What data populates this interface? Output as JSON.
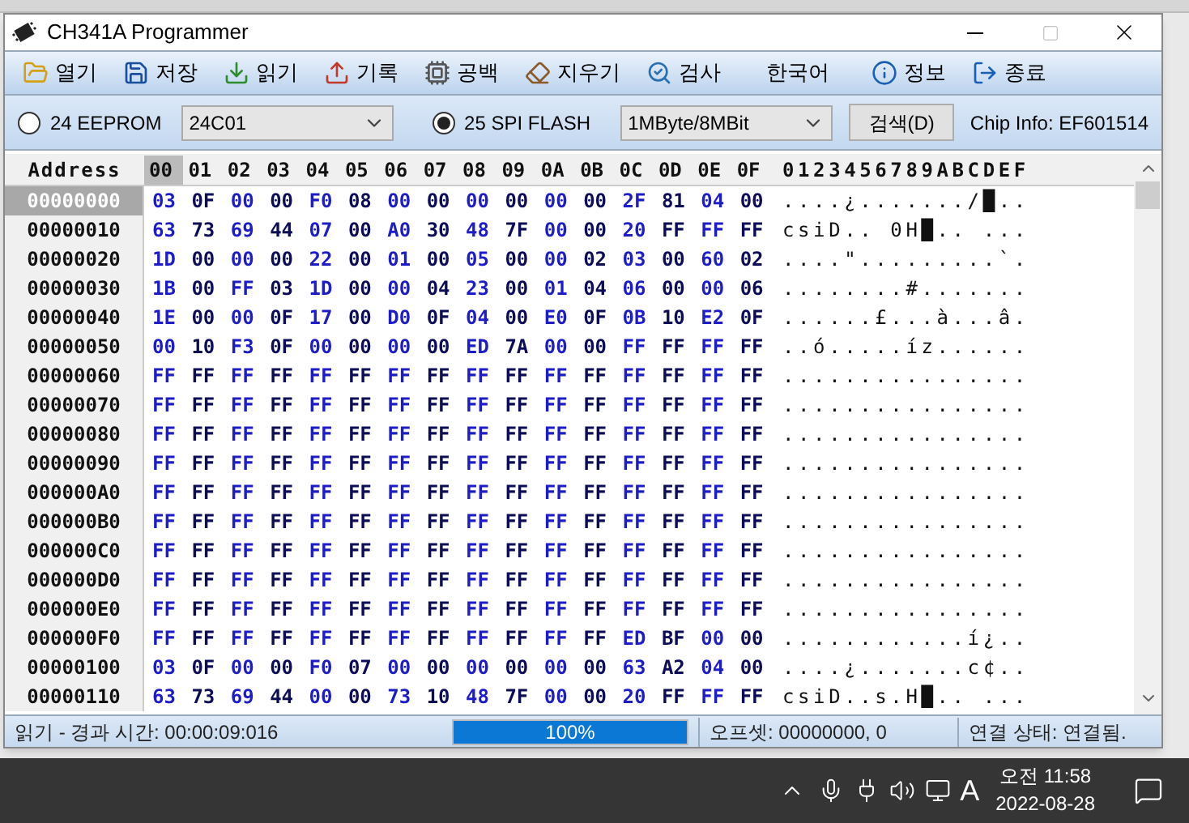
{
  "window": {
    "title": "CH341A Programmer"
  },
  "toolbar": [
    {
      "kind": "open",
      "label": "열기"
    },
    {
      "kind": "save",
      "label": "저장"
    },
    {
      "kind": "read",
      "label": "읽기"
    },
    {
      "kind": "write",
      "label": "기록"
    },
    {
      "kind": "blank",
      "label": "공백"
    },
    {
      "kind": "erase",
      "label": "지우기"
    },
    {
      "kind": "verify",
      "label": "검사"
    },
    {
      "kind": "language",
      "label": "한국어"
    },
    {
      "kind": "info",
      "label": "정보"
    },
    {
      "kind": "exit",
      "label": "종료"
    }
  ],
  "options": {
    "chip_types": [
      {
        "label": "24 EEPROM",
        "selected": false,
        "select_value": "24C01"
      },
      {
        "label": "25 SPI FLASH",
        "selected": true,
        "select_value": "1MByte/8MBit"
      }
    ],
    "detect_button": "검색(D)",
    "chip_info": "Chip Info: EF601514"
  },
  "hex": {
    "address_header": "Address",
    "columns": [
      "00",
      "01",
      "02",
      "03",
      "04",
      "05",
      "06",
      "07",
      "08",
      "09",
      "0A",
      "0B",
      "0C",
      "0D",
      "0E",
      "0F"
    ],
    "ascii_header": "0123456789ABCDEF",
    "rows": [
      {
        "address": "00000000",
        "selected": true,
        "bytes": [
          "03",
          "0F",
          "00",
          "00",
          "F0",
          "08",
          "00",
          "00",
          "00",
          "00",
          "00",
          "00",
          "2F",
          "81",
          "04",
          "00"
        ],
        "ascii": "....¿......./█.."
      },
      {
        "address": "00000010",
        "selected": false,
        "bytes": [
          "63",
          "73",
          "69",
          "44",
          "07",
          "00",
          "A0",
          "30",
          "48",
          "7F",
          "00",
          "00",
          "20",
          "FF",
          "FF",
          "FF"
        ],
        "ascii": "csiD.. 0H█.. ..."
      },
      {
        "address": "00000020",
        "selected": false,
        "bytes": [
          "1D",
          "00",
          "00",
          "00",
          "22",
          "00",
          "01",
          "00",
          "05",
          "00",
          "00",
          "02",
          "03",
          "00",
          "60",
          "02"
        ],
        "ascii": "....\".........`."
      },
      {
        "address": "00000030",
        "selected": false,
        "bytes": [
          "1B",
          "00",
          "FF",
          "03",
          "1D",
          "00",
          "00",
          "04",
          "23",
          "00",
          "01",
          "04",
          "06",
          "00",
          "00",
          "06"
        ],
        "ascii": "........#......."
      },
      {
        "address": "00000040",
        "selected": false,
        "bytes": [
          "1E",
          "00",
          "00",
          "0F",
          "17",
          "00",
          "D0",
          "0F",
          "04",
          "00",
          "E0",
          "0F",
          "0B",
          "10",
          "E2",
          "0F"
        ],
        "ascii": "......£...à...â."
      },
      {
        "address": "00000050",
        "selected": false,
        "bytes": [
          "00",
          "10",
          "F3",
          "0F",
          "00",
          "00",
          "00",
          "00",
          "ED",
          "7A",
          "00",
          "00",
          "FF",
          "FF",
          "FF",
          "FF"
        ],
        "ascii": "..ó.....íz......"
      },
      {
        "address": "00000060",
        "selected": false,
        "bytes": [
          "FF",
          "FF",
          "FF",
          "FF",
          "FF",
          "FF",
          "FF",
          "FF",
          "FF",
          "FF",
          "FF",
          "FF",
          "FF",
          "FF",
          "FF",
          "FF"
        ],
        "ascii": "................"
      },
      {
        "address": "00000070",
        "selected": false,
        "bytes": [
          "FF",
          "FF",
          "FF",
          "FF",
          "FF",
          "FF",
          "FF",
          "FF",
          "FF",
          "FF",
          "FF",
          "FF",
          "FF",
          "FF",
          "FF",
          "FF"
        ],
        "ascii": "................"
      },
      {
        "address": "00000080",
        "selected": false,
        "bytes": [
          "FF",
          "FF",
          "FF",
          "FF",
          "FF",
          "FF",
          "FF",
          "FF",
          "FF",
          "FF",
          "FF",
          "FF",
          "FF",
          "FF",
          "FF",
          "FF"
        ],
        "ascii": "................"
      },
      {
        "address": "00000090",
        "selected": false,
        "bytes": [
          "FF",
          "FF",
          "FF",
          "FF",
          "FF",
          "FF",
          "FF",
          "FF",
          "FF",
          "FF",
          "FF",
          "FF",
          "FF",
          "FF",
          "FF",
          "FF"
        ],
        "ascii": "................"
      },
      {
        "address": "000000A0",
        "selected": false,
        "bytes": [
          "FF",
          "FF",
          "FF",
          "FF",
          "FF",
          "FF",
          "FF",
          "FF",
          "FF",
          "FF",
          "FF",
          "FF",
          "FF",
          "FF",
          "FF",
          "FF"
        ],
        "ascii": "................"
      },
      {
        "address": "000000B0",
        "selected": false,
        "bytes": [
          "FF",
          "FF",
          "FF",
          "FF",
          "FF",
          "FF",
          "FF",
          "FF",
          "FF",
          "FF",
          "FF",
          "FF",
          "FF",
          "FF",
          "FF",
          "FF"
        ],
        "ascii": "................"
      },
      {
        "address": "000000C0",
        "selected": false,
        "bytes": [
          "FF",
          "FF",
          "FF",
          "FF",
          "FF",
          "FF",
          "FF",
          "FF",
          "FF",
          "FF",
          "FF",
          "FF",
          "FF",
          "FF",
          "FF",
          "FF"
        ],
        "ascii": "................"
      },
      {
        "address": "000000D0",
        "selected": false,
        "bytes": [
          "FF",
          "FF",
          "FF",
          "FF",
          "FF",
          "FF",
          "FF",
          "FF",
          "FF",
          "FF",
          "FF",
          "FF",
          "FF",
          "FF",
          "FF",
          "FF"
        ],
        "ascii": "................"
      },
      {
        "address": "000000E0",
        "selected": false,
        "bytes": [
          "FF",
          "FF",
          "FF",
          "FF",
          "FF",
          "FF",
          "FF",
          "FF",
          "FF",
          "FF",
          "FF",
          "FF",
          "FF",
          "FF",
          "FF",
          "FF"
        ],
        "ascii": "................"
      },
      {
        "address": "000000F0",
        "selected": false,
        "bytes": [
          "FF",
          "FF",
          "FF",
          "FF",
          "FF",
          "FF",
          "FF",
          "FF",
          "FF",
          "FF",
          "FF",
          "FF",
          "ED",
          "BF",
          "00",
          "00"
        ],
        "ascii": "............í¿.."
      },
      {
        "address": "00000100",
        "selected": false,
        "bytes": [
          "03",
          "0F",
          "00",
          "00",
          "F0",
          "07",
          "00",
          "00",
          "00",
          "00",
          "00",
          "00",
          "63",
          "A2",
          "04",
          "00"
        ],
        "ascii": "....¿.......c¢.."
      },
      {
        "address": "00000110",
        "selected": false,
        "bytes": [
          "63",
          "73",
          "69",
          "44",
          "00",
          "00",
          "73",
          "10",
          "48",
          "7F",
          "00",
          "00",
          "20",
          "FF",
          "FF",
          "FF"
        ],
        "ascii": "csiD..s.H█.. ..."
      }
    ]
  },
  "status_bar": {
    "message": "읽기 - 경과 시간: 00:00:09:016",
    "progress": {
      "level": 1,
      "label": "100%"
    },
    "offset": "오프셋: 00000000, 0",
    "connection": "연결 상태: 연결됨."
  },
  "taskbar": {
    "input_indicator": "A",
    "time": "오전 11:58",
    "date": "2022-08-28"
  }
}
